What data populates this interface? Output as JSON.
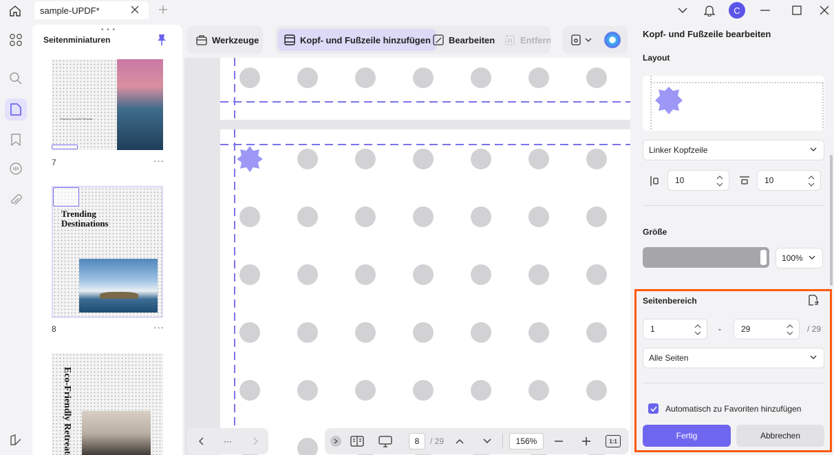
{
  "titlebar": {
    "tab_title": "sample-UPDF*",
    "avatar_letter": "C"
  },
  "thumbnails": {
    "title": "Seitenminiaturen",
    "pages": [
      {
        "number": "7",
        "more": "···",
        "caption": "Relaxing Seaside Retreats"
      },
      {
        "number": "8",
        "more": "···",
        "heading": "Trending Destinations"
      },
      {
        "heading": "Eco-Friendly Retreats"
      }
    ]
  },
  "toolbar": {
    "tools_label": "Werkzeuge",
    "header_footer_label": "Kopf- und Fußzeile hinzufügen",
    "edit_label": "Bearbeiten",
    "remove_label": "Entfernen"
  },
  "bottom_nav": {
    "more": "···",
    "current_page": "8",
    "total_pages": "/ 29",
    "zoom": "156%",
    "fit_label": "1:1"
  },
  "right_panel": {
    "title": "Kopf- und Fußzeile bearbeiten",
    "layout_label": "Layout",
    "position_select": "Linker Kopfzeile",
    "margin_left": "10",
    "margin_top": "10",
    "size_label": "Größe",
    "size_value": "100%",
    "size_level_percent": 100,
    "page_range_label": "Seitenbereich",
    "range_from": "1",
    "range_separator": "-",
    "range_to": "29",
    "range_total": "/ 29",
    "pages_select": "Alle Seiten",
    "favorites_label": "Automatisch zu Favoriten hinzufügen",
    "favorites_checked": true,
    "confirm_label": "Fertig",
    "cancel_label": "Abbrechen"
  },
  "colors": {
    "accent": "#6f66f0",
    "highlight": "#ff5a0f",
    "dashed_guide": "#7a73e8",
    "watermark_shape": "#9d97f6"
  }
}
